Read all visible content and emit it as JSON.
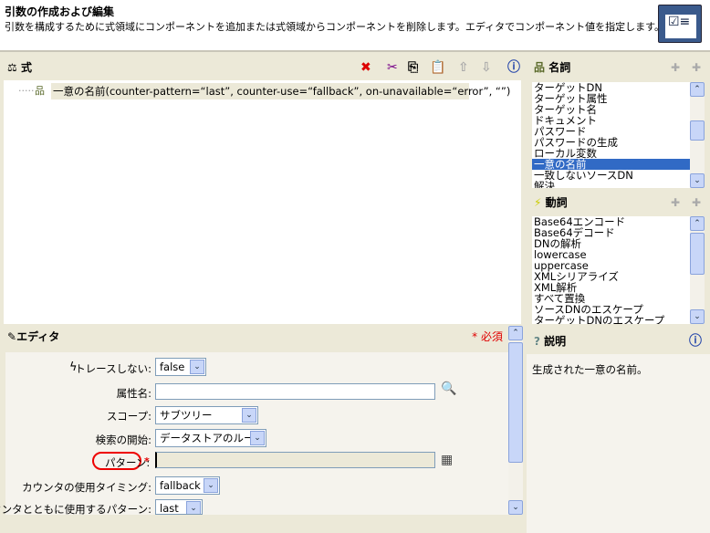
{
  "header": {
    "title": "引数の作成および編集",
    "subtitle": "引数を構成するために式領域にコンポーネントを追加または式領域からコンポーネントを削除します。エディタでコンポーネント値を指定します。"
  },
  "expression": {
    "title": "式",
    "tree_item": "一意の名前(counter-pattern=“last”, counter-use=“fallback”, on-unavailable=“error”, “”)"
  },
  "nouns": {
    "title": "名詞",
    "items": [
      "ターゲットDN",
      "ターゲット属性",
      "ターゲット名",
      "ドキュメント",
      "パスワード",
      "パスワードの生成",
      "ローカル変数",
      "一意の名前",
      "一致しないソースDN",
      "解決"
    ],
    "selected": "一意の名前"
  },
  "verbs": {
    "title": "動詞",
    "items": [
      "Base64エンコード",
      "Base64デコード",
      "DNの解析",
      "lowercase",
      "uppercase",
      "XMLシリアライズ",
      "XML解析",
      "すべて置換",
      "ソースDNのエスケープ",
      "ターゲットDNのエスケープ"
    ]
  },
  "description": {
    "title": "説明",
    "text": "生成された一意の名前。"
  },
  "editor": {
    "title": "エディタ",
    "required": "* 必須",
    "fields": {
      "trace": {
        "label": "トレースしない:",
        "value": "false"
      },
      "attr": {
        "label": "属性名:",
        "value": ""
      },
      "scope": {
        "label": "スコープ:",
        "value": "サブツリー"
      },
      "start": {
        "label": "検索の開始:",
        "value": "データストアのルート"
      },
      "pattern": {
        "label": "パターン:",
        "required": "*",
        "value": ""
      },
      "counter_use": {
        "label": "カウンタの使用タイミング:",
        "value": "fallback"
      },
      "counter_pattern": {
        "label": "カウンタとともに使用するパターン:",
        "value": "last"
      }
    }
  },
  "colors": {
    "selection": "#316ac5",
    "required": "#e00000",
    "panel": "#ece9d8"
  }
}
